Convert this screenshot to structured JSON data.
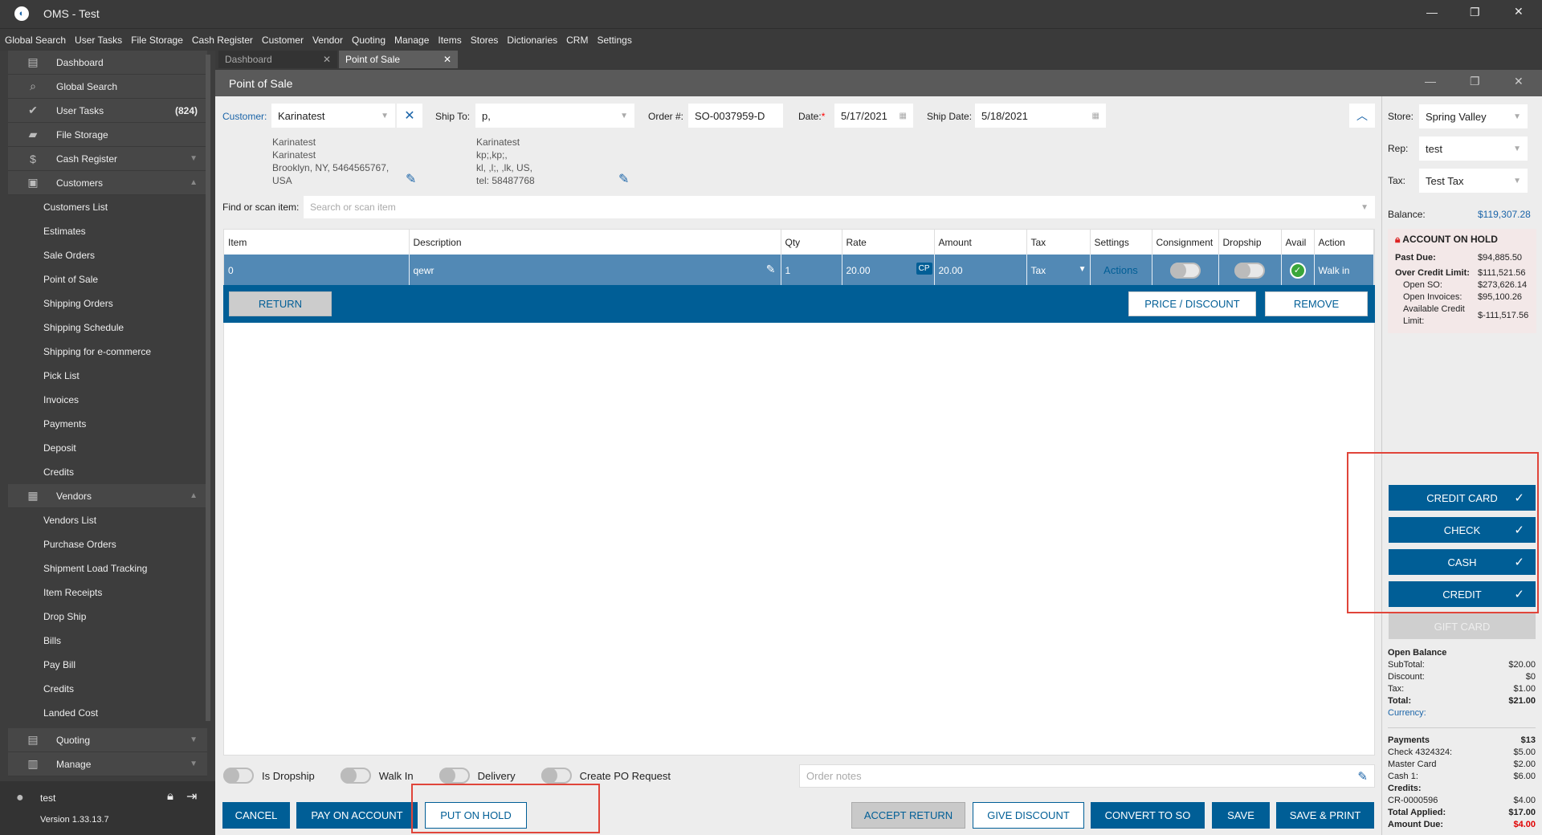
{
  "app": {
    "title": "OMS - Test"
  },
  "menu": [
    "Global Search",
    "User Tasks",
    "File Storage",
    "Cash Register",
    "Customer",
    "Vendor",
    "Quoting",
    "Manage",
    "Items",
    "Stores",
    "Dictionaries",
    "CRM",
    "Settings"
  ],
  "sidebar": {
    "top": [
      {
        "label": "Dashboard",
        "icon": "dashboard-icon"
      },
      {
        "label": "Global Search",
        "icon": "search-icon"
      },
      {
        "label": "User Tasks",
        "icon": "check-circle-icon",
        "count": "(824)"
      },
      {
        "label": "File Storage",
        "icon": "folder-icon"
      },
      {
        "label": "Cash Register",
        "icon": "dollar-icon"
      }
    ],
    "customers": {
      "label": "Customers",
      "items": [
        "Customers List",
        "Estimates",
        "Sale Orders",
        "Point of Sale",
        "Shipping Orders",
        "Shipping Schedule",
        "Shipping for e-commerce",
        "Pick List",
        "Invoices",
        "Payments",
        "Deposit",
        "Credits"
      ]
    },
    "vendors": {
      "label": "Vendors",
      "items": [
        "Vendors List",
        "Purchase Orders",
        "Shipment Load Tracking",
        "Item Receipts",
        "Drop Ship",
        "Bills",
        "Pay Bill",
        "Credits",
        "Landed Cost"
      ]
    },
    "quoting": "Quoting",
    "manage": "Manage",
    "user": "test",
    "version": "Version 1.33.13.7"
  },
  "tabs": [
    {
      "label": "Dashboard"
    },
    {
      "label": "Point of Sale"
    }
  ],
  "window": {
    "title": "Point of Sale"
  },
  "header": {
    "customer_label": "Customer:",
    "customer": "Karinatest",
    "customer_address": [
      "Karinatest",
      "Karinatest",
      "Brooklyn, NY, 5464565767,",
      "USA"
    ],
    "ship_to_label": "Ship To:",
    "ship_to": "p,",
    "ship_address": [
      "Karinatest",
      "kp;,kp;,",
      "kl, ,l;, ,lk, US,",
      "tel: 58487768"
    ],
    "order_label": "Order #:",
    "order": "SO-0037959-D",
    "date_label": "Date:",
    "date": "5/17/2021",
    "ship_date_label": "Ship Date:",
    "ship_date": "5/18/2021",
    "find_label": "Find or scan item:",
    "find_placeholder": "Search or scan item"
  },
  "table": {
    "columns": [
      "Item",
      "Description",
      "Qty",
      "Rate",
      "Amount",
      "Tax",
      "Settings",
      "Consignment",
      "Dropship",
      "Avail",
      "Action"
    ],
    "row": {
      "item": "0",
      "description": "qewr",
      "qty": "1",
      "rate": "20.00",
      "cp": "CP",
      "amount": "20.00",
      "tax": "Tax",
      "settings": "Actions",
      "action": "Walk in"
    },
    "buttons": {
      "return": "RETURN",
      "price_discount": "PRICE / DISCOUNT",
      "remove": "REMOVE"
    }
  },
  "options": {
    "is_dropship": "Is Dropship",
    "walk_in": "Walk In",
    "delivery": "Delivery",
    "create_po": "Create PO Request",
    "notes_placeholder": "Order notes"
  },
  "footer": {
    "cancel": "CANCEL",
    "pay_on_account": "PAY ON ACCOUNT",
    "put_on_hold": "PUT ON HOLD",
    "accept_return": "ACCEPT RETURN",
    "give_discount": "GIVE DISCOUNT",
    "convert_to_so": "CONVERT TO SO",
    "save": "SAVE",
    "save_print": "SAVE & PRINT"
  },
  "right": {
    "store_label": "Store:",
    "store": "Spring Valley",
    "rep_label": "Rep:",
    "rep": "test",
    "tax_label": "Tax:",
    "tax": "Test Tax",
    "balance_label": "Balance:",
    "balance": "$119,307.28",
    "hold": {
      "title": "ACCOUNT ON HOLD",
      "past_due_label": "Past Due:",
      "past_due": "$94,885.50",
      "over_label": "Over Credit Limit:",
      "over": "$111,521.56",
      "open_so_label": "Open SO:",
      "open_so": "$273,626.14",
      "open_inv_label": "Open Invoices:",
      "open_inv": "$95,100.26",
      "avail_label": "Available Credit Limit:",
      "avail": "$-111,517.56"
    },
    "payments_buttons": [
      "CREDIT CARD",
      "CHECK",
      "CASH",
      "CREDIT"
    ],
    "gift_card": "GIFT CARD",
    "summary": {
      "open_balance": "Open Balance",
      "subtotal_label": "SubTotal:",
      "subtotal": "$20.00",
      "discount_label": "Discount:",
      "discount": "$0",
      "tax_label": "Tax:",
      "tax": "$1.00",
      "total_label": "Total:",
      "total": "$21.00",
      "currency_label": "Currency:",
      "payments_label": "Payments",
      "payments": "$13",
      "check_label": "Check 4324324:",
      "check": "$5.00",
      "mc_label": "Master Card",
      "mc": "$2.00",
      "cash_label": "Cash 1:",
      "cash": "$6.00",
      "credits_label": "Credits:",
      "cr_label": "CR-0000596",
      "cr": "$4.00",
      "applied_label": "Total Applied:",
      "applied": "$17.00",
      "due_label": "Amount Due:",
      "due": "$4.00"
    }
  },
  "colors": {
    "accent": "#005e96",
    "row": "#5289b5",
    "due": "#e00000",
    "highlight": "#e0453a"
  }
}
